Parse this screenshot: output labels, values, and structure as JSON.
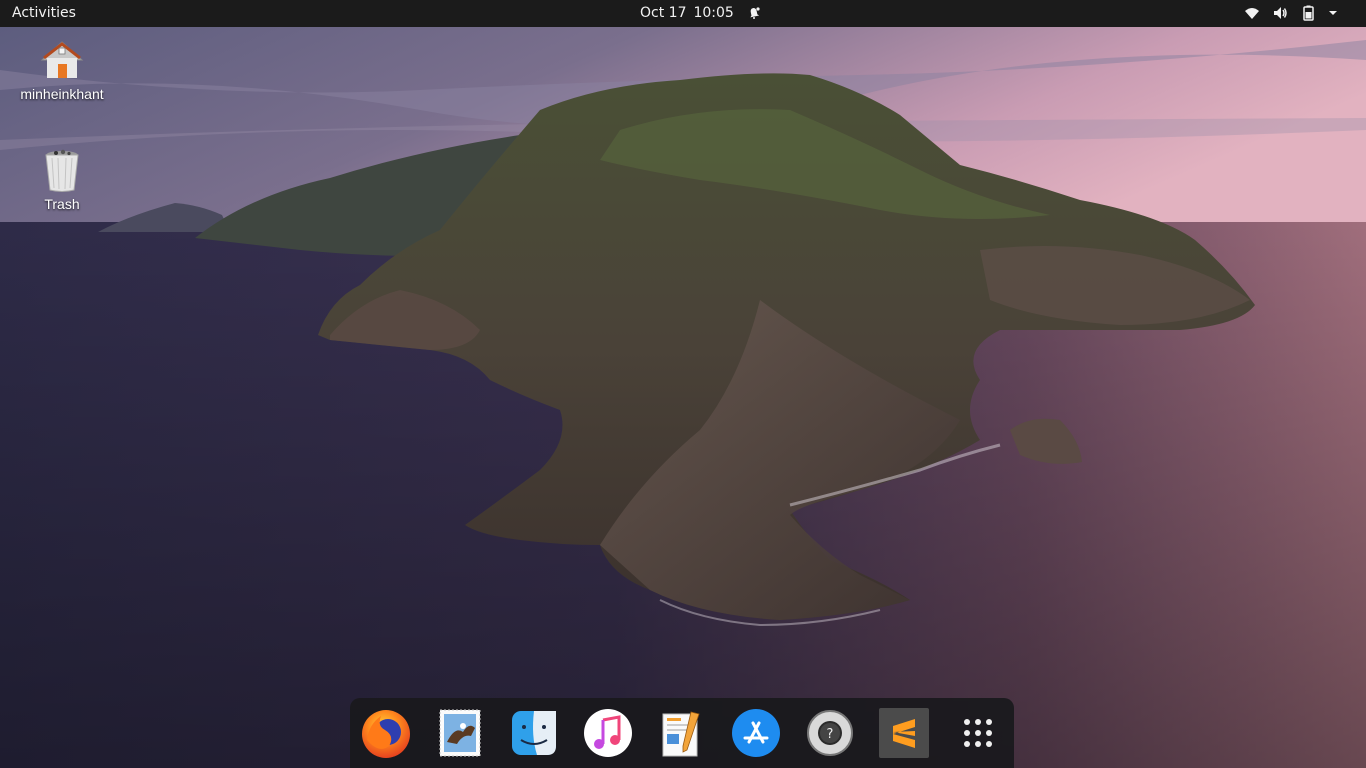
{
  "topbar": {
    "activities_label": "Activities",
    "date": "Oct 17",
    "time": "10:05",
    "notification_icon": "bell-alert-icon",
    "tray_icons": [
      "wifi-icon",
      "volume-icon",
      "battery-icon",
      "chevron-down-icon"
    ]
  },
  "desktop": {
    "icons": [
      {
        "label": "minheinkhant",
        "icon": "home-folder-icon"
      },
      {
        "label": "Trash",
        "icon": "trash-icon"
      }
    ]
  },
  "dock": {
    "apps": [
      {
        "name": "Firefox",
        "icon": "firefox-icon"
      },
      {
        "name": "Mail",
        "icon": "mail-stamp-icon"
      },
      {
        "name": "Finder",
        "icon": "finder-icon"
      },
      {
        "name": "Music",
        "icon": "music-icon"
      },
      {
        "name": "Pages",
        "icon": "pages-icon"
      },
      {
        "name": "App Store",
        "icon": "app-store-icon"
      },
      {
        "name": "Help",
        "icon": "help-lifebuoy-icon"
      },
      {
        "name": "Sublime Text",
        "icon": "sublime-text-icon"
      },
      {
        "name": "Show Applications",
        "icon": "app-grid-icon"
      }
    ]
  },
  "colors": {
    "topbar_bg": "#1b1b1b",
    "dock_bg": "#19191c",
    "sky_top": "#6f6a8c",
    "sky_horizon": "#d9a9b9",
    "sea_dark": "#2a2740",
    "sea_pink": "#8a5a6a"
  }
}
